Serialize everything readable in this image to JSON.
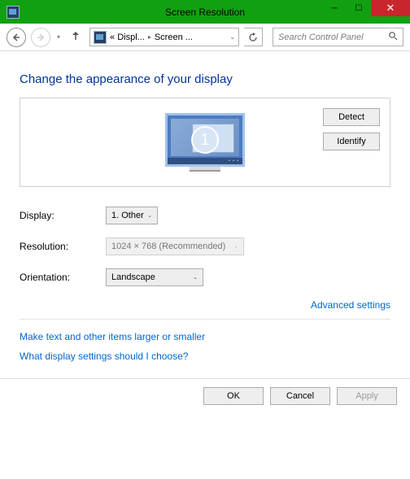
{
  "window": {
    "title": "Screen Resolution"
  },
  "breadcrumb": {
    "crumb1": "« Displ...",
    "crumb2": "Screen ..."
  },
  "search": {
    "placeholder": "Search Control Panel"
  },
  "heading": "Change the appearance of your display",
  "monitor": {
    "number": "1"
  },
  "buttons": {
    "detect": "Detect",
    "identify": "Identify"
  },
  "labels": {
    "display": "Display:",
    "resolution": "Resolution:",
    "orientation": "Orientation:"
  },
  "values": {
    "display": "1. Other",
    "resolution": "1024 × 768 (Recommended)",
    "orientation": "Landscape"
  },
  "links": {
    "advanced": "Advanced settings",
    "textsize": "Make text and other items larger or smaller",
    "help": "What display settings should I choose?"
  },
  "footer": {
    "ok": "OK",
    "cancel": "Cancel",
    "apply": "Apply"
  }
}
